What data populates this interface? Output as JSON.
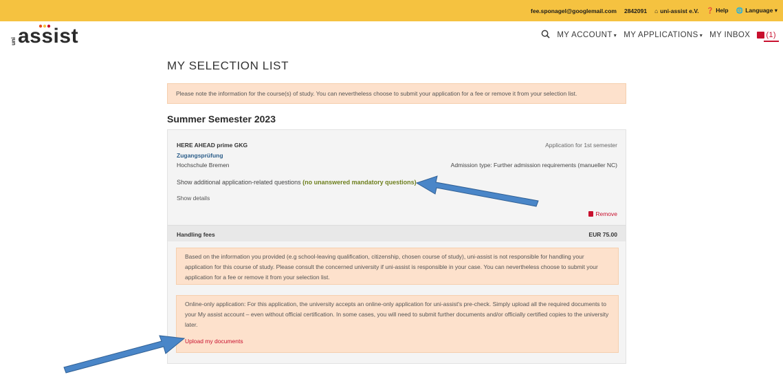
{
  "topbar": {
    "email": "fee.sponagel@googlemail.com",
    "user_id": "2842091",
    "org_link": "uni-assist e.V.",
    "help": "Help",
    "language": "Language",
    "color": "#f5c240"
  },
  "logo": {
    "small": "uni",
    "word": "assist"
  },
  "nav": {
    "account": "MY ACCOUNT",
    "applications": "MY APPLICATIONS",
    "inbox": "MY INBOX",
    "inbox_count": "(1)",
    "search_icon": "search-icon"
  },
  "page": {
    "title": "MY SELECTION LIST",
    "notice": "Please note the information for the course(s) of study. You can nevertheless choose to submit your application for a fee or remove it from your selection list.",
    "semester": "Summer Semester 2023"
  },
  "course": {
    "name": "HERE AHEAD prime GKG",
    "application_type": "Application for 1st semester",
    "subtitle": "Zugangsprüfung",
    "university": "Hochschule Bremen",
    "admission": "Admission type: Further admission requirements (manueller NC)",
    "questions_label": "Show additional application-related questions",
    "questions_status": "(no unanswered mandatory questions)",
    "show_details": "Show details",
    "remove": "Remove"
  },
  "fees": {
    "label": "Handling fees",
    "amount": "EUR 75.00",
    "warning": "Based on the information you provided (e.g school-leaving qualification, citizenship, chosen course of study), uni-assist is not responsible for handling your application for this course of study. Please consult the concerned university if uni-assist is responsible in your case. You can nevertheless choose to submit your application for a fee or remove it from your selection list.",
    "online_info": "Online-only application: For this application, the university accepts an online-only application for uni-assist's pre-check. Simply upload all the required documents to your My assist account – even without official certification. In some cases, you will need to submit further documents and/or officially certified copies to the university later.",
    "upload_link": "Upload my documents"
  },
  "colors": {
    "accent_red": "#c8102e",
    "warning_bg": "#fde1cc",
    "status_green": "#6e7f1e",
    "annotation_arrow": "#4a86c8"
  }
}
